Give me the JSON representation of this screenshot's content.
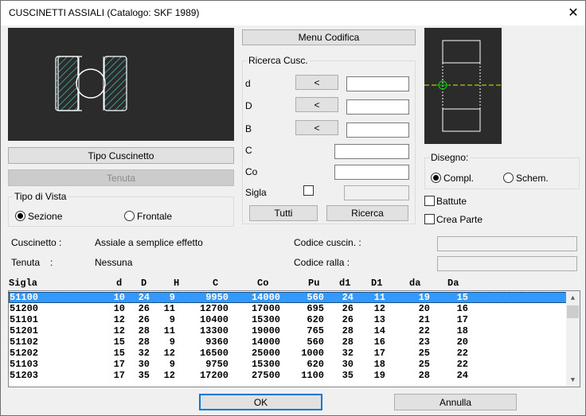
{
  "window": {
    "title": "CUSCINETTI ASSIALI (Catalogo: SKF 1989)",
    "close_glyph": "✕"
  },
  "buttons": {
    "menu_codifica": "Menu Codifica",
    "tipo_cuscinetto": "Tipo Cuscinetto",
    "tenuta": "Tenuta",
    "tutti": "Tutti",
    "ricerca": "Ricerca",
    "ok": "OK",
    "annulla": "Annulla",
    "less_than": "<"
  },
  "ricerca_group": {
    "label": "Ricerca Cusc.",
    "fields": [
      "d",
      "D",
      "B",
      "C",
      "Co",
      "Sigla"
    ]
  },
  "tipo_vista": {
    "label": "Tipo di Vista",
    "options": [
      "Sezione",
      "Frontale"
    ],
    "selected": "Sezione"
  },
  "disegno": {
    "label": "Disegno:",
    "options": [
      "Compl.",
      "Schem."
    ],
    "selected": "Compl."
  },
  "checkboxes": {
    "battute": "Battute",
    "crea_parte": "Crea Parte"
  },
  "info": {
    "cuscinetto_label": "Cuscinetto :",
    "cuscinetto_value": "Assiale a semplice effetto",
    "tenuta_label": "Tenuta",
    "tenuta_colon": ":",
    "tenuta_value": "Nessuna",
    "codice_cuscin_label": "Codice cuscin. :",
    "codice_ralla_label": "Codice ralla   :"
  },
  "table": {
    "columns": [
      "Sigla",
      "d",
      "D",
      "H",
      "C",
      "Co",
      "Pu",
      "d1",
      "D1",
      "da",
      "Da"
    ],
    "rows": [
      [
        "51100",
        "10",
        "24",
        "9",
        "9950",
        "14000",
        "560",
        "24",
        "11",
        "19",
        "15"
      ],
      [
        "51200",
        "10",
        "26",
        "11",
        "12700",
        "17000",
        "695",
        "26",
        "12",
        "20",
        "16"
      ],
      [
        "51101",
        "12",
        "26",
        "9",
        "10400",
        "15300",
        "620",
        "26",
        "13",
        "21",
        "17"
      ],
      [
        "51201",
        "12",
        "28",
        "11",
        "13300",
        "19000",
        "765",
        "28",
        "14",
        "22",
        "18"
      ],
      [
        "51102",
        "15",
        "28",
        "9",
        "9360",
        "14000",
        "560",
        "28",
        "16",
        "23",
        "20"
      ],
      [
        "51202",
        "15",
        "32",
        "12",
        "16500",
        "25000",
        "1000",
        "32",
        "17",
        "25",
        "22"
      ],
      [
        "51103",
        "17",
        "30",
        "9",
        "9750",
        "15300",
        "620",
        "30",
        "18",
        "25",
        "22"
      ],
      [
        "51203",
        "17",
        "35",
        "12",
        "17200",
        "27500",
        "1100",
        "35",
        "19",
        "28",
        "24"
      ]
    ],
    "selected_index": 0
  },
  "colors": {
    "accent": "#0078d7",
    "selection": "#3399ff",
    "preview_bg": "#2b2b2b",
    "hatch": "#4fd6c8",
    "centerline": "#e6e600",
    "origin": "#00cc00"
  }
}
